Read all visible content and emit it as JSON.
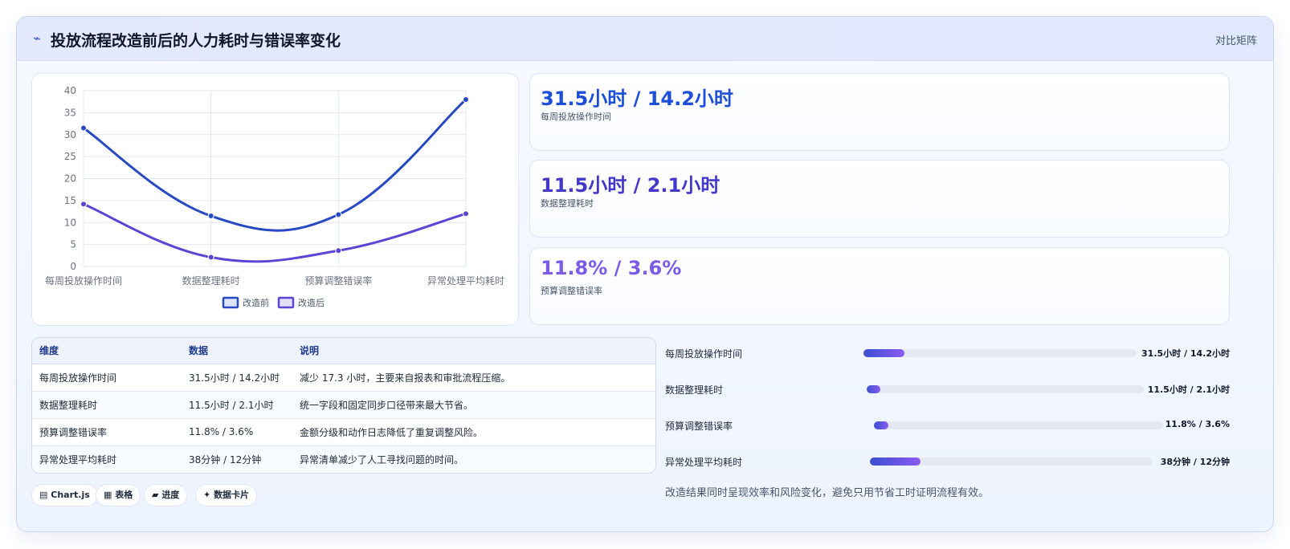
{
  "header": {
    "icon": "bolt-icon",
    "title": "投放流程改造前后的人力耗时与错误率变化",
    "tag": "对比矩阵"
  },
  "colors": {
    "before": "#2849c4",
    "after": "#5b45d4",
    "stat1": "#1d4ed8",
    "stat2": "#4338ca",
    "stat3": "#7c5ce6"
  },
  "chart_data": {
    "type": "line",
    "categories": [
      "每周投放操作时间",
      "数据整理耗时",
      "预算调整错误率",
      "异常处理平均耗时"
    ],
    "series": [
      {
        "name": "改造前",
        "values": [
          31.5,
          11.5,
          11.8,
          38
        ]
      },
      {
        "name": "改造后",
        "values": [
          14.2,
          2.1,
          3.6,
          12
        ]
      }
    ],
    "ylim": [
      0,
      40
    ],
    "yticks": [
      0,
      5,
      10,
      15,
      20,
      25,
      30,
      35,
      40
    ],
    "grid": true,
    "legend": "bottom"
  },
  "stats": [
    {
      "value": "31.5小时 / 14.2小时",
      "label": "每周投放操作时间"
    },
    {
      "value": "11.5小时 / 2.1小时",
      "label": "数据整理耗时"
    },
    {
      "value": "11.8% / 3.6%",
      "label": "预算调整错误率"
    }
  ],
  "table": {
    "headers": [
      "维度",
      "数据",
      "说明"
    ],
    "rows": [
      [
        "每周投放操作时间",
        "31.5小时 / 14.2小时",
        "减少 17.3 小时，主要来自报表和审批流程压缩。"
      ],
      [
        "数据整理耗时",
        "11.5小时 / 2.1小时",
        "统一字段和固定同步口径带来最大节省。"
      ],
      [
        "预算调整错误率",
        "11.8% / 3.6%",
        "金额分级和动作日志降低了重复调整风险。"
      ],
      [
        "异常处理平均耗时",
        "38分钟 / 12分钟",
        "异常清单减少了人工寻找问题的时间。"
      ]
    ]
  },
  "badges": [
    {
      "icon": "chart-icon",
      "label": "Chart.js"
    },
    {
      "icon": "table-icon",
      "label": "表格"
    },
    {
      "icon": "progress-icon",
      "label": "进度"
    },
    {
      "icon": "sparkle-icon",
      "label": "数据卡片"
    }
  ],
  "progress": [
    {
      "label": "每周投放操作时间",
      "value": "31.5小时 / 14.2小时",
      "fill": 0.15
    },
    {
      "label": "数据整理耗时",
      "value": "11.5小时 / 2.1小时",
      "fill": 0.05
    },
    {
      "label": "预算调整错误率",
      "value": "11.8% / 3.6%",
      "fill": 0.05
    },
    {
      "label": "异常处理平均耗时",
      "value": "38分钟 / 12分钟",
      "fill": 0.18
    }
  ],
  "note": "改造结果同时呈现效率和风险变化，避免只用节省工时证明流程有效。"
}
